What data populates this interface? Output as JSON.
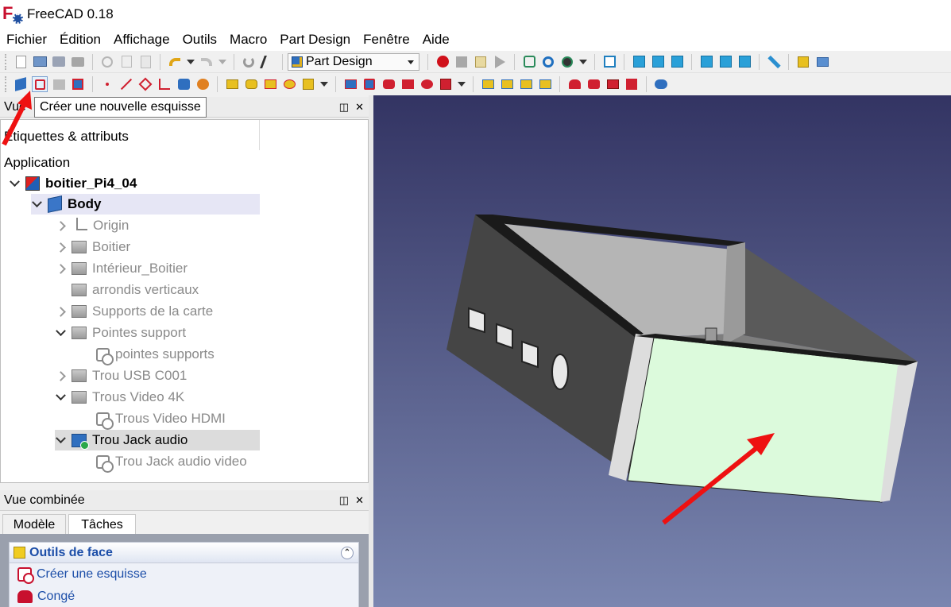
{
  "window": {
    "title": "FreeCAD 0.18"
  },
  "menu": [
    "Fichier",
    "Édition",
    "Affichage",
    "Outils",
    "Macro",
    "Part Design",
    "Fenêtre",
    "Aide"
  ],
  "toolbar": {
    "workbench": "Part Design"
  },
  "tooltip": "Créer une nouvelle esquisse",
  "tree_panel": {
    "title": "Vue",
    "column": "Étiquettes & attributs",
    "section": "Application",
    "items": [
      {
        "label": "boitier_Pi4_04",
        "icon": "document-icon",
        "style": "bold"
      },
      {
        "label": "Body",
        "icon": "body-icon",
        "style": "bold"
      },
      {
        "label": "Origin",
        "icon": "origin-icon",
        "style": "grey"
      },
      {
        "label": "Boitier",
        "icon": "pad-icon",
        "style": "grey"
      },
      {
        "label": "Intérieur_Boitier",
        "icon": "pocket-icon",
        "style": "grey"
      },
      {
        "label": "arrondis verticaux",
        "icon": "fillet-icon",
        "style": "grey"
      },
      {
        "label": "Supports de la carte",
        "icon": "pad-icon",
        "style": "grey"
      },
      {
        "label": "Pointes support",
        "icon": "pad-icon",
        "style": "grey"
      },
      {
        "label": "pointes supports",
        "icon": "sketch-icon",
        "style": "grey"
      },
      {
        "label": "Trou USB C001",
        "icon": "pocket-icon",
        "style": "grey"
      },
      {
        "label": "Trous Video 4K",
        "icon": "pocket-icon",
        "style": "grey"
      },
      {
        "label": "Trous Video HDMI",
        "icon": "sketch-icon",
        "style": "grey"
      },
      {
        "label": "Trou Jack audio",
        "icon": "pocket-active-icon",
        "style": "dark"
      },
      {
        "label": "Trou Jack audio video",
        "icon": "sketch-icon",
        "style": "grey"
      }
    ]
  },
  "combo_view": {
    "title": "Vue combinée",
    "tabs": [
      "Modèle",
      "Tâches"
    ],
    "active_tab": "Tâches",
    "task_panel": {
      "title": "Outils de face",
      "items": [
        "Créer une esquisse",
        "Congé"
      ]
    }
  },
  "colors": {
    "selected_face": "#dcfadc",
    "arrow": "#ee1111",
    "background_top": "#333463",
    "background_bottom": "#7a86b0"
  }
}
